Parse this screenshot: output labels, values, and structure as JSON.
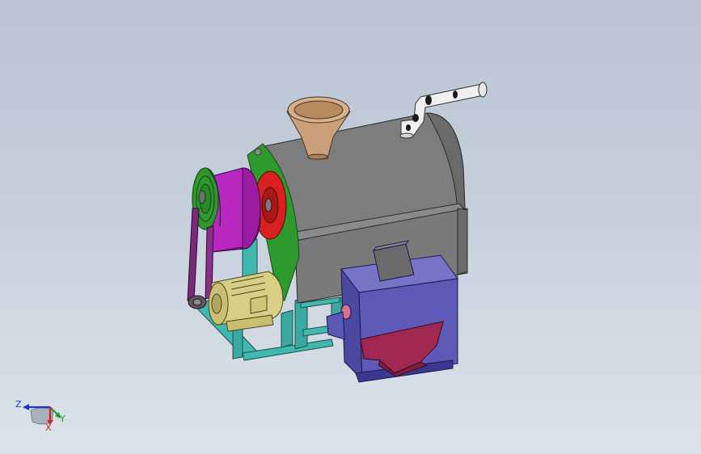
{
  "viewport": {
    "background_top": "#b9c3d2",
    "background_bottom": "#dde3ea"
  },
  "model": {
    "parts": [
      {
        "name": "drum",
        "color": "#7d7d7d"
      },
      {
        "name": "feed-hopper",
        "color": "#c9a07a"
      },
      {
        "name": "exhaust-pipe",
        "color": "#f0f0f0"
      },
      {
        "name": "end-plate",
        "color": "#2e9a2e"
      },
      {
        "name": "bearing-flange",
        "color": "#d82020"
      },
      {
        "name": "pulley-housing",
        "color": "#b020b8"
      },
      {
        "name": "drive-pulley",
        "color": "#2e9a2e"
      },
      {
        "name": "v-belt",
        "color": "#7a2a7a"
      },
      {
        "name": "motor",
        "color": "#d8cf86"
      },
      {
        "name": "frame",
        "color": "#40b8b0"
      },
      {
        "name": "furnace",
        "color": "#5c5ab6"
      },
      {
        "name": "furnace-chute",
        "color": "#a02850"
      }
    ]
  },
  "triad": {
    "z_label": "Z",
    "y_label": "Y",
    "x_label": "X",
    "z_color": "#1a34d6",
    "y_color": "#1f9a28",
    "x_color": "#d52020"
  }
}
